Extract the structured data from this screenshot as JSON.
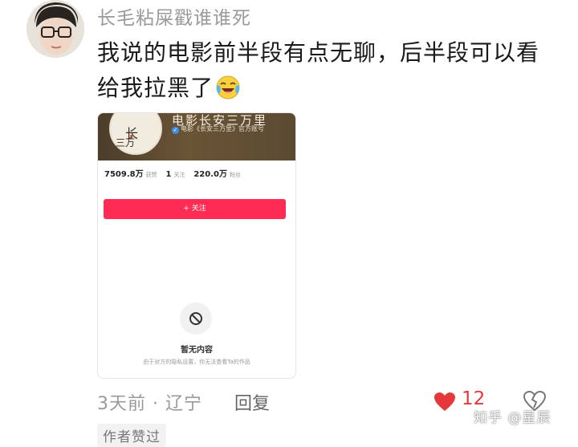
{
  "comment": {
    "username": "长毛粘屎戳谁谁死",
    "text": "我说的电影前半段有点无聊，后半段可以看给我拉黑了",
    "emoji": "crying-laughing-emoji",
    "meta": {
      "time_location": "3天前 · 辽宁",
      "reply_label": "回复",
      "like_count": "12"
    },
    "author_tag": "作者赞过"
  },
  "embedded_card": {
    "account_name": "电影长安三万里",
    "verified_text": "电影《长安三万里》官方账号",
    "stats": [
      {
        "value": "7509.8万",
        "label": "获赞"
      },
      {
        "value": "1",
        "label": "关注"
      },
      {
        "value": "220.0万",
        "label": "粉丝"
      }
    ],
    "follow_button": "+ 关注",
    "empty_title": "暂无内容",
    "empty_desc": "由于对方的隐私设置，你无法查看Ta的作品"
  },
  "watermark": "知乎 @星辰",
  "colors": {
    "accent_red": "#e5383b",
    "follow_button": "#fe2c55",
    "muted_text": "#9a9a9a"
  }
}
